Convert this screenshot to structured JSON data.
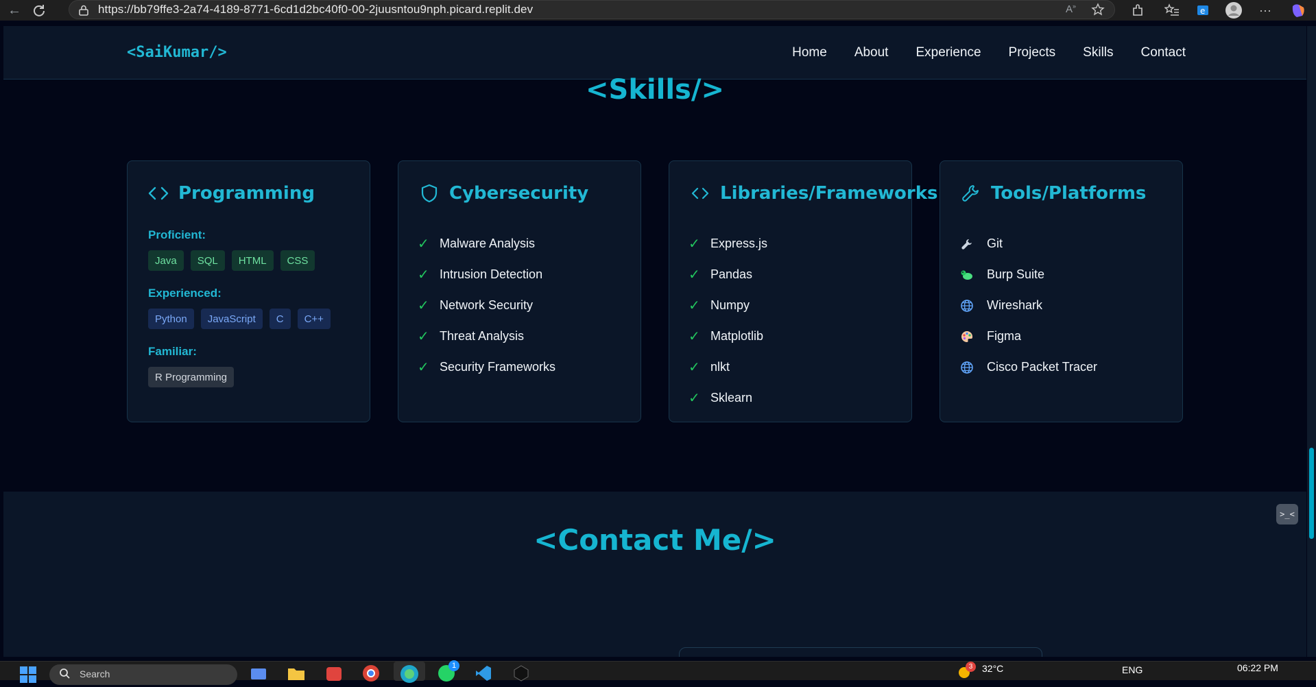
{
  "browser": {
    "url": "https://bb79ffe3-2a74-4189-8771-6cd1d2bc40f0-00-2juusntou9nph.picard.replit.dev"
  },
  "site": {
    "logo": "<SaiKumar/>",
    "nav": [
      "Home",
      "About",
      "Experience",
      "Projects",
      "Skills",
      "Contact"
    ]
  },
  "skills": {
    "title": "<Skills/>",
    "programming": {
      "title": "Programming",
      "icon": "code-icon",
      "proficient_label": "Proficient:",
      "proficient": [
        "Java",
        "SQL",
        "HTML",
        "CSS"
      ],
      "experienced_label": "Experienced:",
      "experienced": [
        "Python",
        "JavaScript",
        "C",
        "C++"
      ],
      "familiar_label": "Familiar:",
      "familiar": [
        "R Programming"
      ]
    },
    "cybersecurity": {
      "title": "Cybersecurity",
      "icon": "shield-icon",
      "items": [
        "Malware Analysis",
        "Intrusion Detection",
        "Network Security",
        "Threat Analysis",
        "Security Frameworks"
      ]
    },
    "libraries": {
      "title": "Libraries/Frameworks",
      "icon": "code-icon",
      "items": [
        "Express.js",
        "Pandas",
        "Numpy",
        "Matplotlib",
        "nlkt",
        "Sklearn"
      ]
    },
    "tools": {
      "title": "Tools/Platforms",
      "icon": "wrench-icon",
      "items": [
        {
          "icon": "wrench-icon",
          "label": "Git"
        },
        {
          "icon": "bug-icon",
          "label": "Burp Suite"
        },
        {
          "icon": "globe-icon",
          "label": "Wireshark"
        },
        {
          "icon": "palette-icon",
          "label": "Figma"
        },
        {
          "icon": "globe-icon",
          "label": "Cisco Packet Tracer"
        }
      ]
    },
    "check_mark": "✓"
  },
  "contact": {
    "title": "<Contact Me/>"
  },
  "taskbar": {
    "search_placeholder": "Search",
    "weather_temp": "32°C",
    "weather_badge": "3",
    "language": "ENG",
    "time": "06:22 PM",
    "app_badge": "1"
  },
  "colors": {
    "accent": "#22b8d4",
    "background": "#020617",
    "card": "#0b1628",
    "check": "#22c55e"
  }
}
